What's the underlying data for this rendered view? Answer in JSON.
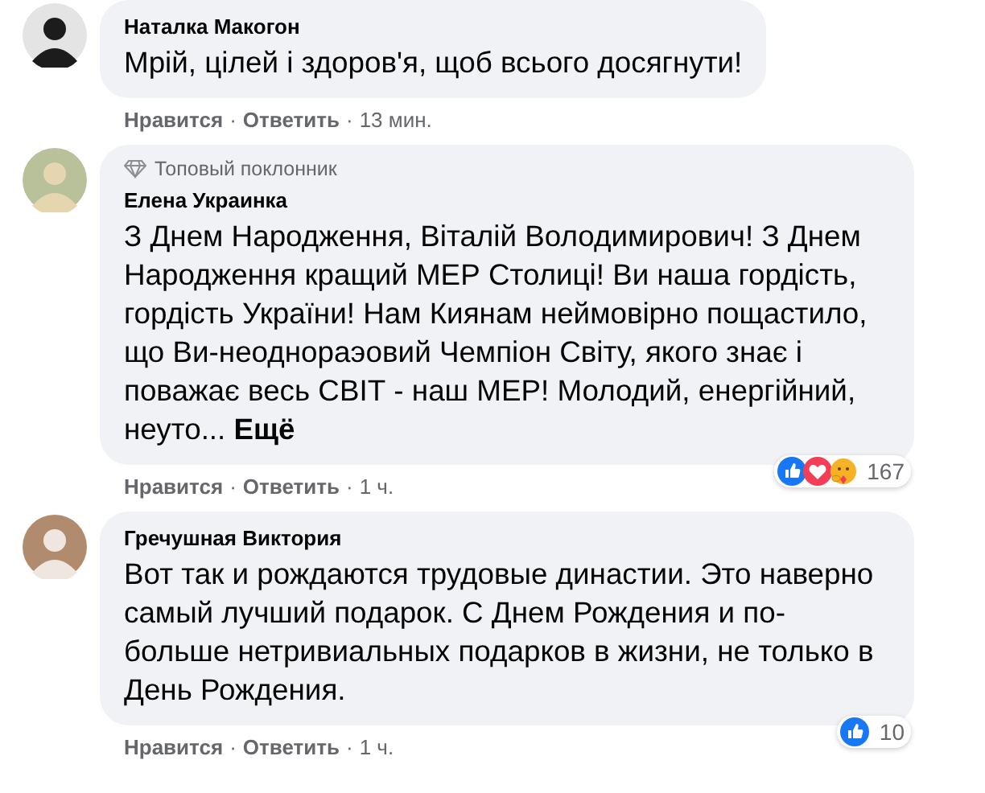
{
  "comments": [
    {
      "author": "Наталка Макогон",
      "text": "Мрій, цілей і здоров'я, щоб всього досягнути!",
      "meta": [
        {
          "kind": "action",
          "text": "Нравится"
        },
        {
          "kind": "separator",
          "text": "·"
        },
        {
          "kind": "action",
          "text": "Ответить"
        },
        {
          "kind": "separator",
          "text": "·"
        },
        {
          "kind": "time",
          "text": "13 мин."
        }
      ]
    },
    {
      "badge": "Топовый поклонник",
      "author": "Елена Украинка",
      "text": "З Днем Народження, Віталій Володимирович! З Днем Народження кращий МЕР Столиці! Ви наша гордість, гордість України! Нам Киянам неймовірно пощастило, що Ви-неоднораэовий Чемпіон Світу, якого знає і поважає весь СВІТ - наш МЕР! Молодий, енергійний, неуто...",
      "more": "Ещё",
      "meta": [
        {
          "kind": "action",
          "text": "Нравится"
        },
        {
          "kind": "separator",
          "text": "·"
        },
        {
          "kind": "action",
          "text": "Ответить"
        },
        {
          "kind": "separator",
          "text": "·"
        },
        {
          "kind": "time",
          "text": "1 ч."
        }
      ],
      "reactions": {
        "icons": [
          {
            "kind": "like"
          },
          {
            "kind": "love"
          },
          {
            "kind": "care"
          }
        ],
        "count": "167"
      }
    },
    {
      "author": "Гречушная Виктория",
      "text": "Вот так и рождаются трудовые династии. Это наверно самый лучший подарок. С Днем Рождения и по-больше нетривиальных подарков в жизни, не только в День Рождения.",
      "meta": [
        {
          "kind": "action",
          "text": "Нравится"
        },
        {
          "kind": "separator",
          "text": "·"
        },
        {
          "kind": "action",
          "text": "Ответить"
        },
        {
          "kind": "separator",
          "text": "·"
        },
        {
          "kind": "time",
          "text": "1 ч."
        }
      ],
      "reactions": {
        "icons": [
          {
            "kind": "like"
          }
        ],
        "count": "10"
      }
    }
  ]
}
